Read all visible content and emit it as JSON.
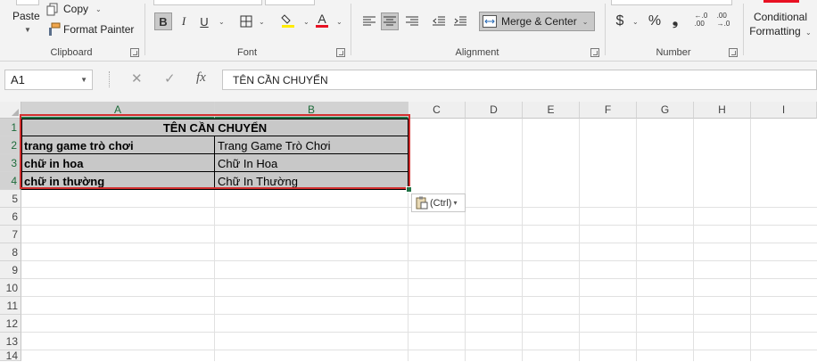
{
  "ribbon": {
    "clipboard": {
      "label": "Clipboard",
      "paste_label": "Paste",
      "copy_label": "Copy",
      "format_painter_label": "Format Painter"
    },
    "font": {
      "label": "Font",
      "bold": "B",
      "italic": "I",
      "underline": "U",
      "font_color_glyph": "A",
      "accent_font_color": "#e81123",
      "accent_fill_color": "#ffeb00"
    },
    "alignment": {
      "label": "Alignment",
      "merge_center_label": "Merge & Center"
    },
    "number": {
      "label": "Number",
      "currency": "$",
      "percent": "%",
      "comma": "❟",
      "increase_decimal": "←.0\n.00",
      "decrease_decimal": ".00\n→.0"
    },
    "styles": {
      "conditional_line1": "Conditional",
      "conditional_line2": "Formatting"
    }
  },
  "formula_bar": {
    "name_box": "A1",
    "cancel": "✕",
    "enter": "✓",
    "fx": "fx",
    "content": "TÊN CẦN CHUYỂN"
  },
  "columns": [
    "A",
    "B",
    "C",
    "D",
    "E",
    "F",
    "G",
    "H",
    "I"
  ],
  "rows": [
    "1",
    "2",
    "3",
    "4",
    "5",
    "6",
    "7",
    "8",
    "9",
    "10",
    "11",
    "12",
    "13",
    "14"
  ],
  "cells": {
    "a1": "TÊN CẦN CHUYỂN",
    "a2": "trang game trò chơi",
    "b2": "Trang Game Trò Chơi",
    "a3": "chữ in hoa",
    "b3": "Chữ In Hoa",
    "a4": "chữ in thường",
    "b4": "Chữ In Thường"
  },
  "paste_options": {
    "label": "(Ctrl)"
  },
  "colors": {
    "excel_green": "#217346",
    "selection_red": "#d32f2f",
    "table_shade": "#c8c8c8"
  }
}
